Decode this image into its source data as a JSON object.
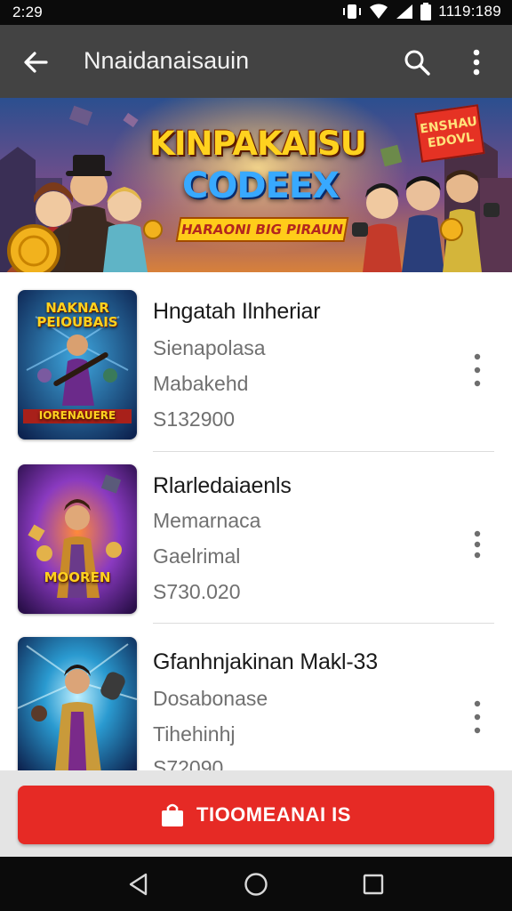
{
  "status_bar": {
    "time": "2:29",
    "clock": "1119:189"
  },
  "app_bar": {
    "title": "Nnaidanaisauin",
    "icons": [
      "back-arrow-icon",
      "search-icon",
      "more-vert-icon"
    ]
  },
  "banner": {
    "title": "KINPAKAISU",
    "subtitle": "CODEEX",
    "ribbon": "HARAONI BIG PIRAUN",
    "badge": "ENSHAU EDOVL"
  },
  "items": [
    {
      "title": "Hngatah Ilnheriar",
      "line1": "Sienapolasa",
      "line2": "Mabakehd",
      "price": "S132900",
      "thumb_top": "NAKNAR PEIOUBAIS",
      "thumb_bottom": "IORENAUERE"
    },
    {
      "title": "Rlarledaiaenls",
      "line1": "Memarnaca",
      "line2": "Gaelrimal",
      "price": "S730.020",
      "thumb_top": "",
      "thumb_bottom": "MOOREN"
    },
    {
      "title": "Gfanhnjakinan Makl-33",
      "line1": "Dosabonase",
      "line2": "Tihehinhj",
      "price": "S72090",
      "thumb_top": "",
      "thumb_bottom": ""
    }
  ],
  "cta": {
    "label": "TIOOMEANAI IS",
    "icon": "shopping-bag-icon"
  },
  "nav": [
    "back-triangle-icon",
    "home-circle-icon",
    "recents-square-icon"
  ],
  "colors": {
    "app_bar": "#434343",
    "accent": "#e62a25",
    "status_bar": "#0b0b0b"
  }
}
